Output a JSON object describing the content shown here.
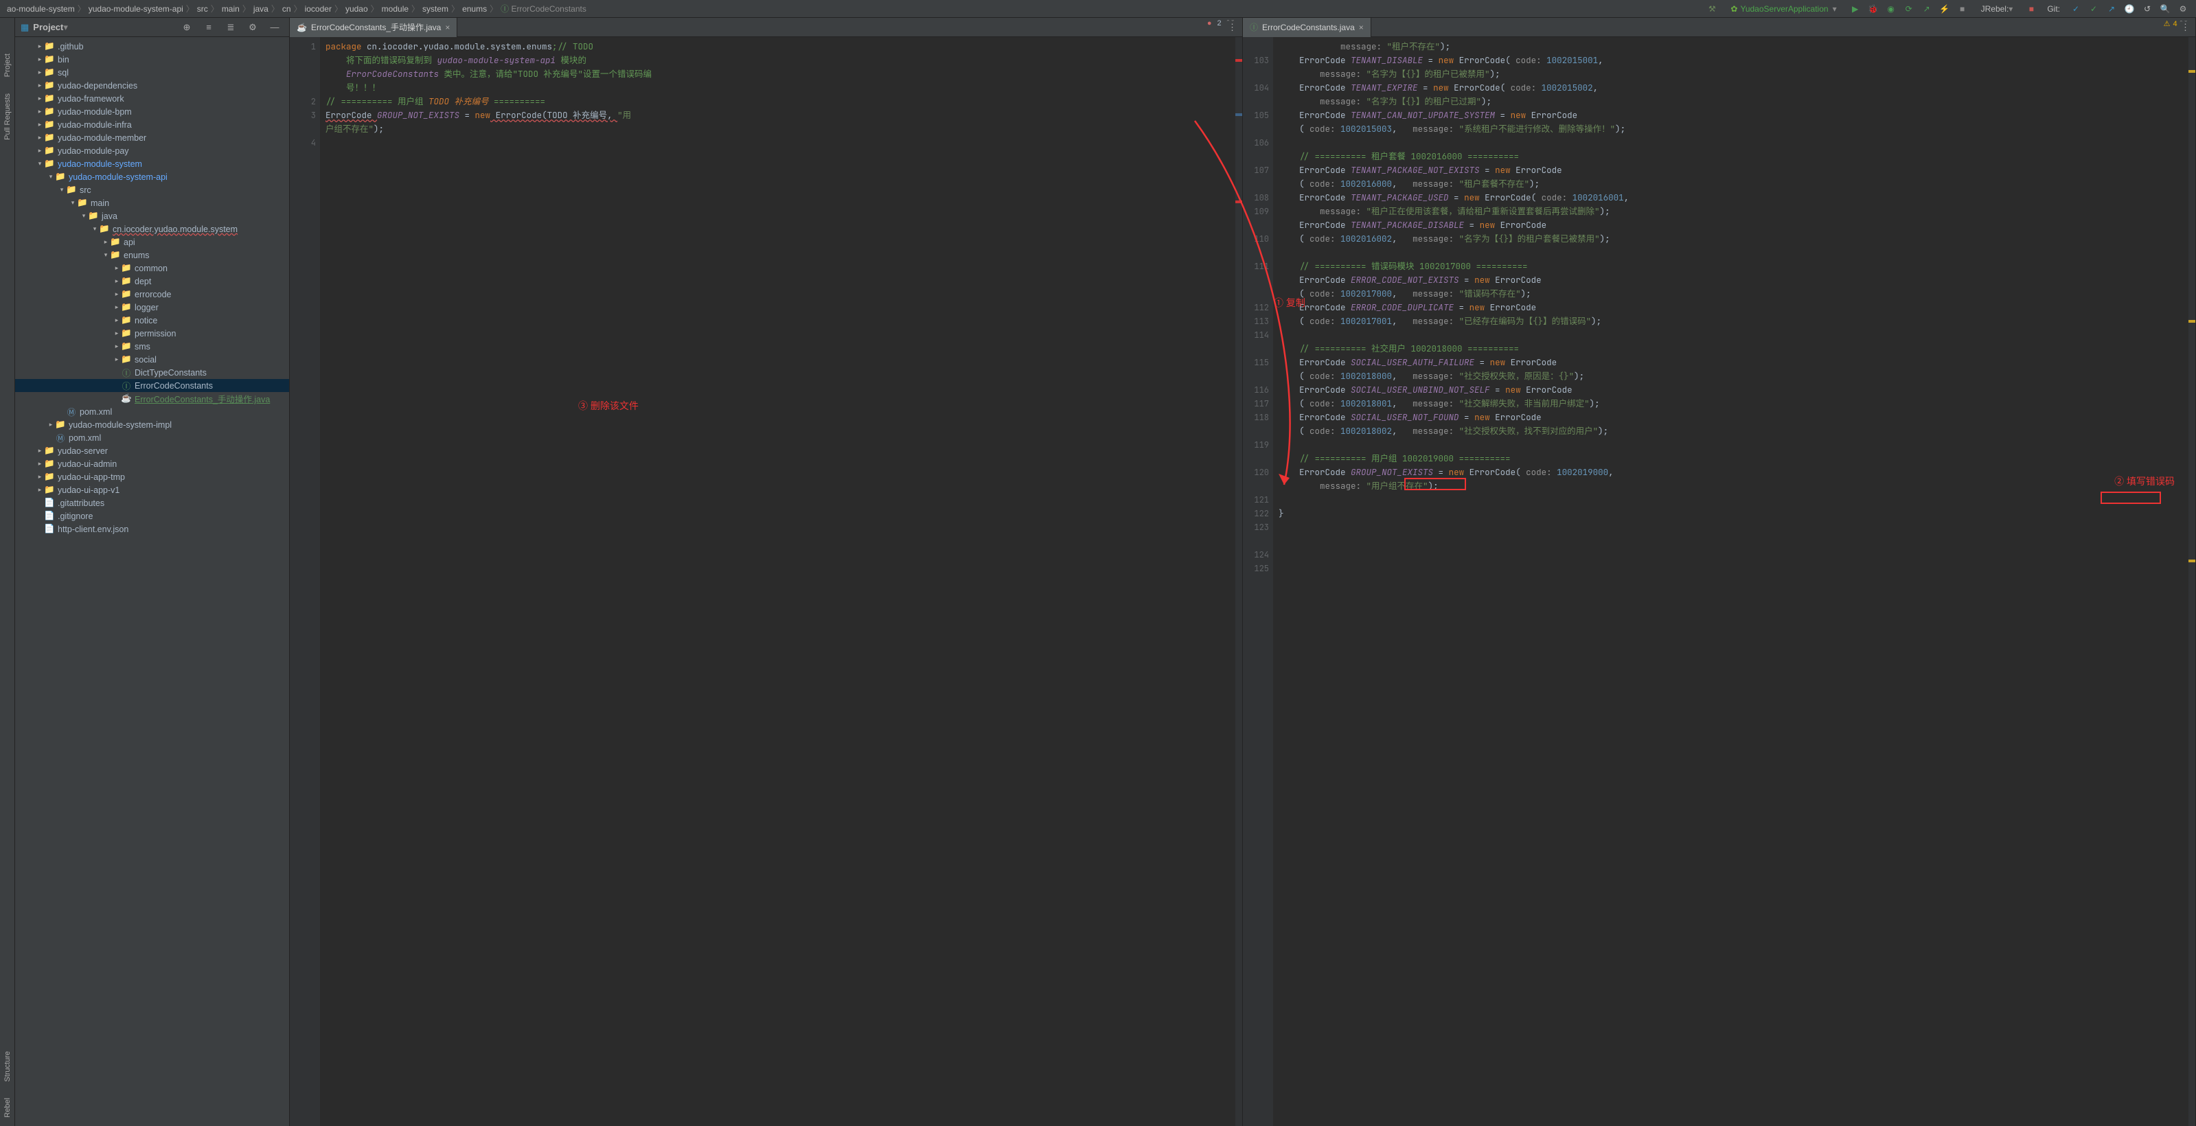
{
  "breadcrumbs": [
    "ao-module-system",
    "yudao-module-system-api",
    "src",
    "main",
    "java",
    "cn",
    "iocoder",
    "yudao",
    "module",
    "system",
    "enums",
    "ErrorCodeConstants"
  ],
  "runConfig": "YudaoServerApplication",
  "jrebelLabel": "JRebel:",
  "gitLabel": "Git:",
  "sideStrips": {
    "project": "Project",
    "pull": "Pull Requests",
    "structure": "Structure",
    "rebel": "Rebel"
  },
  "projectPanel": {
    "title": "Project"
  },
  "tree": [
    {
      "d": 0,
      "a": ">",
      "k": "fld",
      "t": ".github"
    },
    {
      "d": 0,
      "a": ">",
      "k": "fld",
      "t": "bin"
    },
    {
      "d": 0,
      "a": ">",
      "k": "fld",
      "t": "sql"
    },
    {
      "d": 0,
      "a": ">",
      "k": "mod",
      "t": "yudao-dependencies"
    },
    {
      "d": 0,
      "a": ">",
      "k": "mod",
      "t": "yudao-framework"
    },
    {
      "d": 0,
      "a": ">",
      "k": "mod",
      "t": "yudao-module-bpm"
    },
    {
      "d": 0,
      "a": ">",
      "k": "mod",
      "t": "yudao-module-infra"
    },
    {
      "d": 0,
      "a": ">",
      "k": "mod",
      "t": "yudao-module-member"
    },
    {
      "d": 0,
      "a": ">",
      "k": "mod",
      "t": "yudao-module-pay"
    },
    {
      "d": 0,
      "a": "v",
      "k": "mod",
      "t": "yudao-module-system",
      "blue": true
    },
    {
      "d": 1,
      "a": "v",
      "k": "mod",
      "t": "yudao-module-system-api",
      "blue": true
    },
    {
      "d": 2,
      "a": "v",
      "k": "fld",
      "t": "src"
    },
    {
      "d": 3,
      "a": "v",
      "k": "src",
      "t": "main"
    },
    {
      "d": 4,
      "a": "v",
      "k": "src",
      "t": "java"
    },
    {
      "d": 5,
      "a": "v",
      "k": "pkg",
      "t": "cn.iocoder.yudao.module.system",
      "red": true
    },
    {
      "d": 6,
      "a": ">",
      "k": "pkg",
      "t": "api"
    },
    {
      "d": 6,
      "a": "v",
      "k": "pkg",
      "t": "enums"
    },
    {
      "d": 7,
      "a": ">",
      "k": "pkg",
      "t": "common"
    },
    {
      "d": 7,
      "a": ">",
      "k": "pkg",
      "t": "dept"
    },
    {
      "d": 7,
      "a": ">",
      "k": "pkg",
      "t": "errorcode"
    },
    {
      "d": 7,
      "a": ">",
      "k": "pkg",
      "t": "logger"
    },
    {
      "d": 7,
      "a": ">",
      "k": "pkg",
      "t": "notice"
    },
    {
      "d": 7,
      "a": ">",
      "k": "pkg",
      "t": "permission"
    },
    {
      "d": 7,
      "a": ">",
      "k": "pkg",
      "t": "sms"
    },
    {
      "d": 7,
      "a": ">",
      "k": "pkg",
      "t": "social"
    },
    {
      "d": 7,
      "a": "",
      "k": "iface",
      "t": "DictTypeConstants"
    },
    {
      "d": 7,
      "a": "",
      "k": "iface",
      "t": "ErrorCodeConstants",
      "sel": true
    },
    {
      "d": 7,
      "a": "",
      "k": "jfile",
      "t": "ErrorCodeConstants_手动操作.java",
      "green": true
    },
    {
      "d": 2,
      "a": "",
      "k": "mvn",
      "t": "pom.xml"
    },
    {
      "d": 1,
      "a": ">",
      "k": "mod",
      "t": "yudao-module-system-impl"
    },
    {
      "d": 1,
      "a": "",
      "k": "mvn",
      "t": "pom.xml"
    },
    {
      "d": 0,
      "a": ">",
      "k": "mod",
      "t": "yudao-server"
    },
    {
      "d": 0,
      "a": ">",
      "k": "fld",
      "t": "yudao-ui-admin"
    },
    {
      "d": 0,
      "a": ">",
      "k": "fld",
      "t": "yudao-ui-app-tmp"
    },
    {
      "d": 0,
      "a": ">",
      "k": "fld",
      "t": "yudao-ui-app-v1"
    },
    {
      "d": 0,
      "a": "",
      "k": "file",
      "t": ".gitattributes"
    },
    {
      "d": 0,
      "a": "",
      "k": "file",
      "t": ".gitignore"
    },
    {
      "d": 0,
      "a": "",
      "k": "file",
      "t": "http-client.env.json"
    }
  ],
  "leftTab": {
    "name": "ErrorCodeConstants_手动操作.java"
  },
  "leftGutter": [
    "1",
    "",
    "",
    "",
    "2",
    "3",
    "",
    "4"
  ],
  "leftCode": {
    "pkg": "package",
    "pkgName": " cn.iocoder.yudao.module.system.enums",
    "todo": ";// TODO",
    "doc1": "将下面的错误码复制到 ",
    "docRef": "yudao-module-system-api",
    "doc1b": " 模块的",
    "doc2": "ErrorCodeConstants",
    "doc2b": " 类中。注意，请给\"TODO 补充编号\"设置一个错误码编",
    "doc3": "号！！！",
    "cmt": "// ========== 用户组 ",
    "todoRef": "TODO 补充编号",
    " cmtEnd": " ==========",
    "l3a": "ErrorCode ",
    "l3const": "GROUP_NOT_EXISTS",
    "l3eq": " = ",
    "l3new": "new",
    "l3b": " ErrorCode(TODO 补充编号, ",
    "l3str": "\"用",
    "l3str2": "户组不存在\"",
    "l3end": ");"
  },
  "leftErr": "2",
  "rightTab": {
    "name": "ErrorCodeConstants.java"
  },
  "rightWarn": "4",
  "rightGutter": [
    "",
    "103",
    "",
    "104",
    "",
    "105",
    "",
    "106",
    "",
    "107",
    "",
    "108",
    "109",
    "",
    "110",
    "",
    "111",
    "",
    "",
    "112",
    "113",
    "114",
    "",
    "115",
    "",
    "116",
    "117",
    "118",
    "",
    "119",
    "",
    "120",
    "",
    "121",
    "122",
    "123",
    "",
    "124",
    "125"
  ],
  "rightCode": {
    "msg": "message:",
    "code": "code:",
    "tenantNotExists": "\"租户不存在\"",
    "tenantDisable": "TENANT_DISABLE",
    "c1002015001": "1002015001",
    "tenantDisableMsg": "\"名字为【{}】的租户已被禁用\"",
    "tenantExpire": "TENANT_EXPIRE",
    "c1002015002": "1002015002",
    "tenantExpireMsg": "\"名字为【{}】的租户已过期\"",
    "tenantCannotUpdate": "TENANT_CAN_NOT_UPDATE_SYSTEM",
    "c1002015003": "1002015003",
    "tenantCannotUpdateMsg": "\"系统租户不能进行修改、删除等操作！\"",
    "cmtTenantPkg": "// ========== 租户套餐 1002016000 ==========",
    "tenantPkgNotExists": "TENANT_PACKAGE_NOT_EXISTS",
    "c1002016000": "1002016000",
    "tenantPkgNotExistsMsg": "\"租户套餐不存在\"",
    "tenantPkgUsed": "TENANT_PACKAGE_USED",
    "c1002016001": "1002016001",
    "tenantPkgUsedMsg": "\"租户正在使用该套餐，请给租户重新设置套餐后再尝试删除\"",
    "tenantPkgDisable": "TENANT_PACKAGE_DISABLE",
    "c1002016002": "1002016002",
    "tenantPkgDisableMsg": "\"名字为【{}】的租户套餐已被禁用\"",
    "cmtErrCode": "// ========== 错误码模块 1002017000 ==========",
    "errCodeNotExists": "ERROR_CODE_NOT_EXISTS",
    "c1002017000": "1002017000",
    "errCodeNotExistsMsg": "\"错误码不存在\"",
    "errCodeDup": "ERROR_CODE_DUPLICATE",
    "c1002017001": "1002017001",
    "errCodeDupMsg": "\"已经存在编码为【{}】的错误码\"",
    "cmtSocial": "// ========== 社交用户 1002018000 ==========",
    "socialAuthFail": "SOCIAL_USER_AUTH_FAILURE",
    "c1002018000": "1002018000",
    "socialAuthFailMsg": "\"社交授权失败，原因是：{}\"",
    "socialUnbind": "SOCIAL_USER_UNBIND_NOT_SELF",
    "c1002018001": "1002018001",
    "socialUnbindMsg": "\"社交解绑失败，非当前用户绑定\"",
    "socialNotFound": "SOCIAL_USER_NOT_FOUND",
    "c1002018002": "1002018002",
    "socialNotFoundMsg": "\"社交授权失败，找不到对应的用户\"",
    "cmtGroup": "// ========== 用户组 1002019000 ==========",
    "groupNotExists": "GROUP_NOT_EXISTS",
    "c1002019000": "1002019000",
    "groupNotExistsMsg": "\"用户组不存在\"",
    "errorCodeType": "ErrorCode",
    "newKw": "new",
    "closeBrace": "}"
  },
  "annotations": {
    "copy": "① 复制",
    "fill": "② 填写错误码",
    "delete": "③ 删除该文件"
  }
}
